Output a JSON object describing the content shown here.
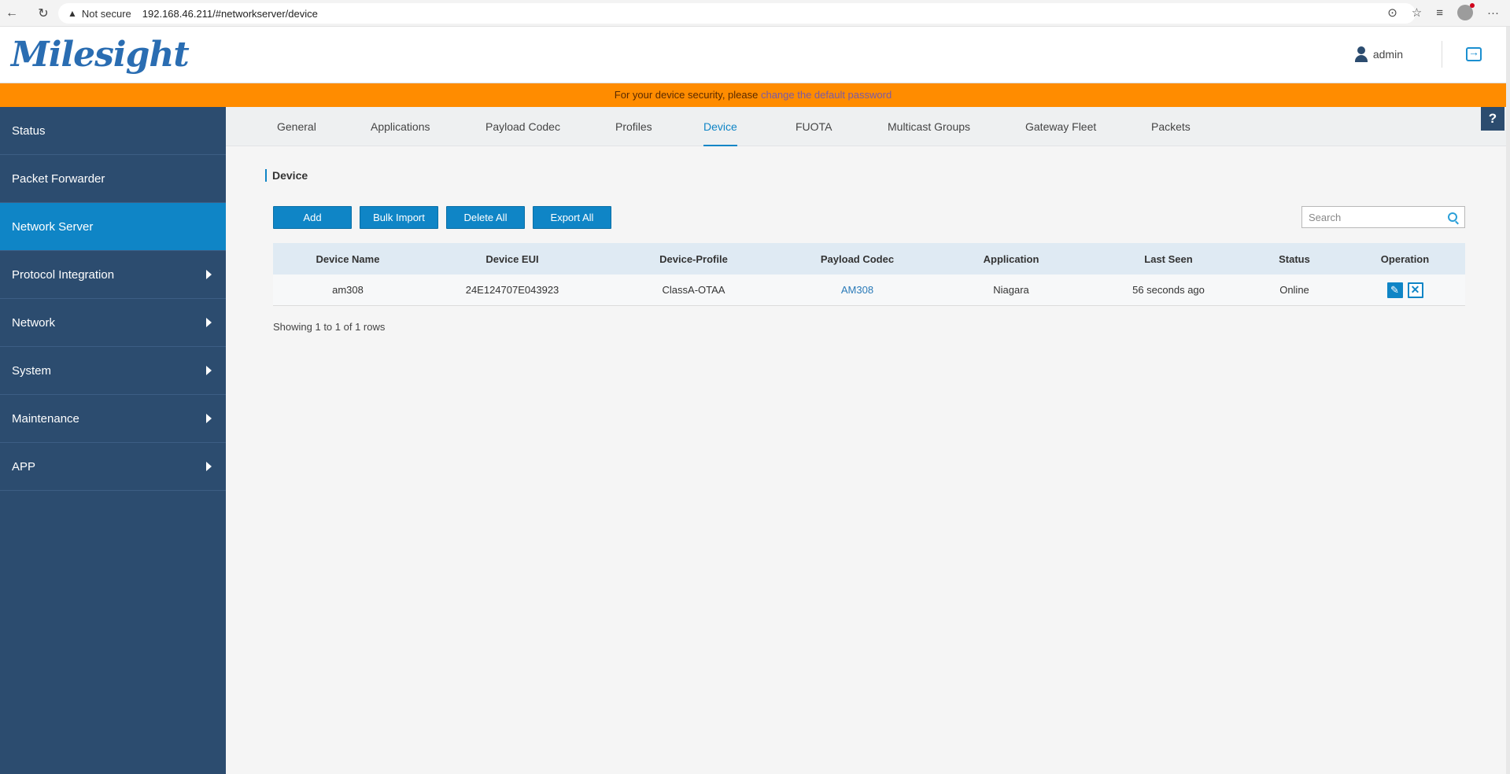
{
  "browser": {
    "security_label": "Not secure",
    "url": "192.168.46.211/#networkserver/device",
    "more_label": "···"
  },
  "header": {
    "logo_text": "Milesight",
    "user": "admin"
  },
  "banner": {
    "text": "For your device security, please ",
    "link": "change the default password"
  },
  "sidebar": {
    "items": [
      {
        "label": "Status"
      },
      {
        "label": "Packet Forwarder"
      },
      {
        "label": "Network Server"
      },
      {
        "label": "Protocol Integration"
      },
      {
        "label": "Network"
      },
      {
        "label": "System"
      },
      {
        "label": "Maintenance"
      },
      {
        "label": "APP"
      }
    ]
  },
  "tabs": [
    {
      "label": "General"
    },
    {
      "label": "Applications"
    },
    {
      "label": "Payload Codec"
    },
    {
      "label": "Profiles"
    },
    {
      "label": "Device"
    },
    {
      "label": "FUOTA"
    },
    {
      "label": "Multicast Groups"
    },
    {
      "label": "Gateway Fleet"
    },
    {
      "label": "Packets"
    }
  ],
  "help_label": "?",
  "section_title": "Device",
  "toolbar": {
    "add": "Add",
    "bulk_import": "Bulk Import",
    "delete_all": "Delete All",
    "export_all": "Export All",
    "search_placeholder": "Search"
  },
  "table": {
    "headers": [
      "Device Name",
      "Device EUI",
      "Device-Profile",
      "Payload Codec",
      "Application",
      "Last Seen",
      "Status",
      "Operation"
    ],
    "rows": [
      {
        "device_name": "am308",
        "device_eui": "24E124707E043923",
        "device_profile": "ClassA-OTAA",
        "payload_codec": "AM308",
        "application": "Niagara",
        "last_seen": "56 seconds ago",
        "status": "Online"
      }
    ]
  },
  "pagination": {
    "showing": "Showing 1 to 1 of 1 rows"
  },
  "colors": {
    "sidebar_bg": "#2c4c6f",
    "accent": "#0f85c6",
    "banner": "#ff8c00"
  }
}
